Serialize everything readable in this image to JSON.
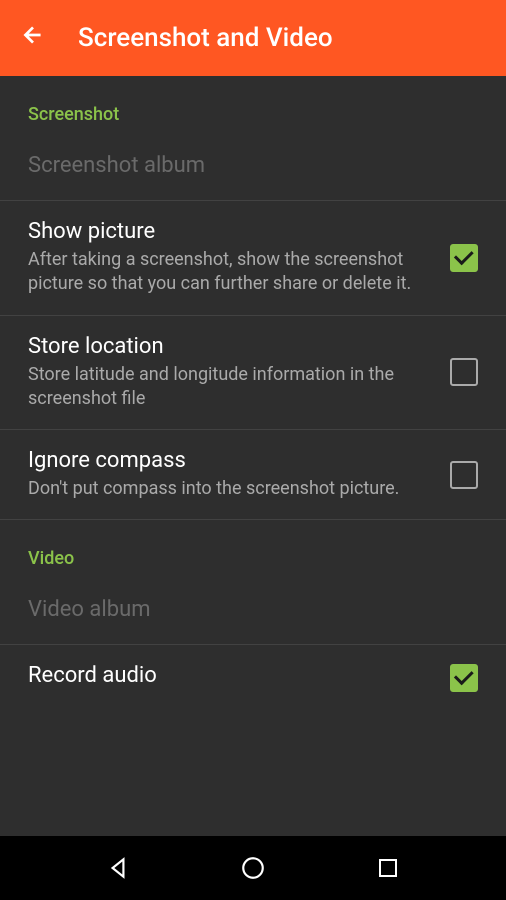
{
  "header": {
    "title": "Screenshot and Video"
  },
  "sections": {
    "screenshot": {
      "label": "Screenshot",
      "items": {
        "album": {
          "title": "Screenshot album"
        },
        "show_picture": {
          "title": "Show picture",
          "desc": "After taking a screenshot, show the screenshot picture so that you can further share or delete it.",
          "checked": true
        },
        "store_location": {
          "title": "Store location",
          "desc": "Store latitude and longitude information in the screenshot file",
          "checked": false
        },
        "ignore_compass": {
          "title": "Ignore compass",
          "desc": "Don't put compass into the screenshot picture.",
          "checked": false
        }
      }
    },
    "video": {
      "label": "Video",
      "items": {
        "album": {
          "title": "Video album"
        },
        "record_audio": {
          "title": "Record audio",
          "checked": true
        }
      }
    }
  }
}
